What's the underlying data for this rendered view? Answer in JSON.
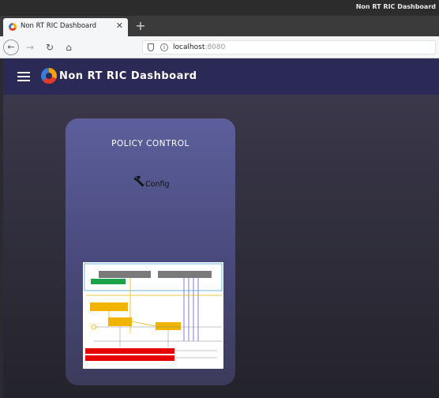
{
  "os": {
    "window_title": "Non RT RIC Dashboard"
  },
  "browser": {
    "tab": {
      "title": "Non RT RIC Dashboard"
    },
    "url": {
      "host": "localhost",
      "port": ":8080"
    }
  },
  "app": {
    "title": "Non RT RIC Dashboard",
    "brand_color": "#2b2955"
  },
  "card": {
    "title": "POLICY CONTROL",
    "config_label": "Config"
  },
  "icons": {
    "tab_favicon": "onap-logo-icon",
    "tab_close": "close-icon",
    "new_tab": "plus-icon",
    "back": "back-arrow-icon",
    "forward": "forward-arrow-icon",
    "reload": "reload-icon",
    "home": "home-icon",
    "shield": "shield-icon",
    "info": "info-icon",
    "menu": "hamburger-icon",
    "logo": "onap-logo-icon",
    "config": "wrench-icon"
  }
}
